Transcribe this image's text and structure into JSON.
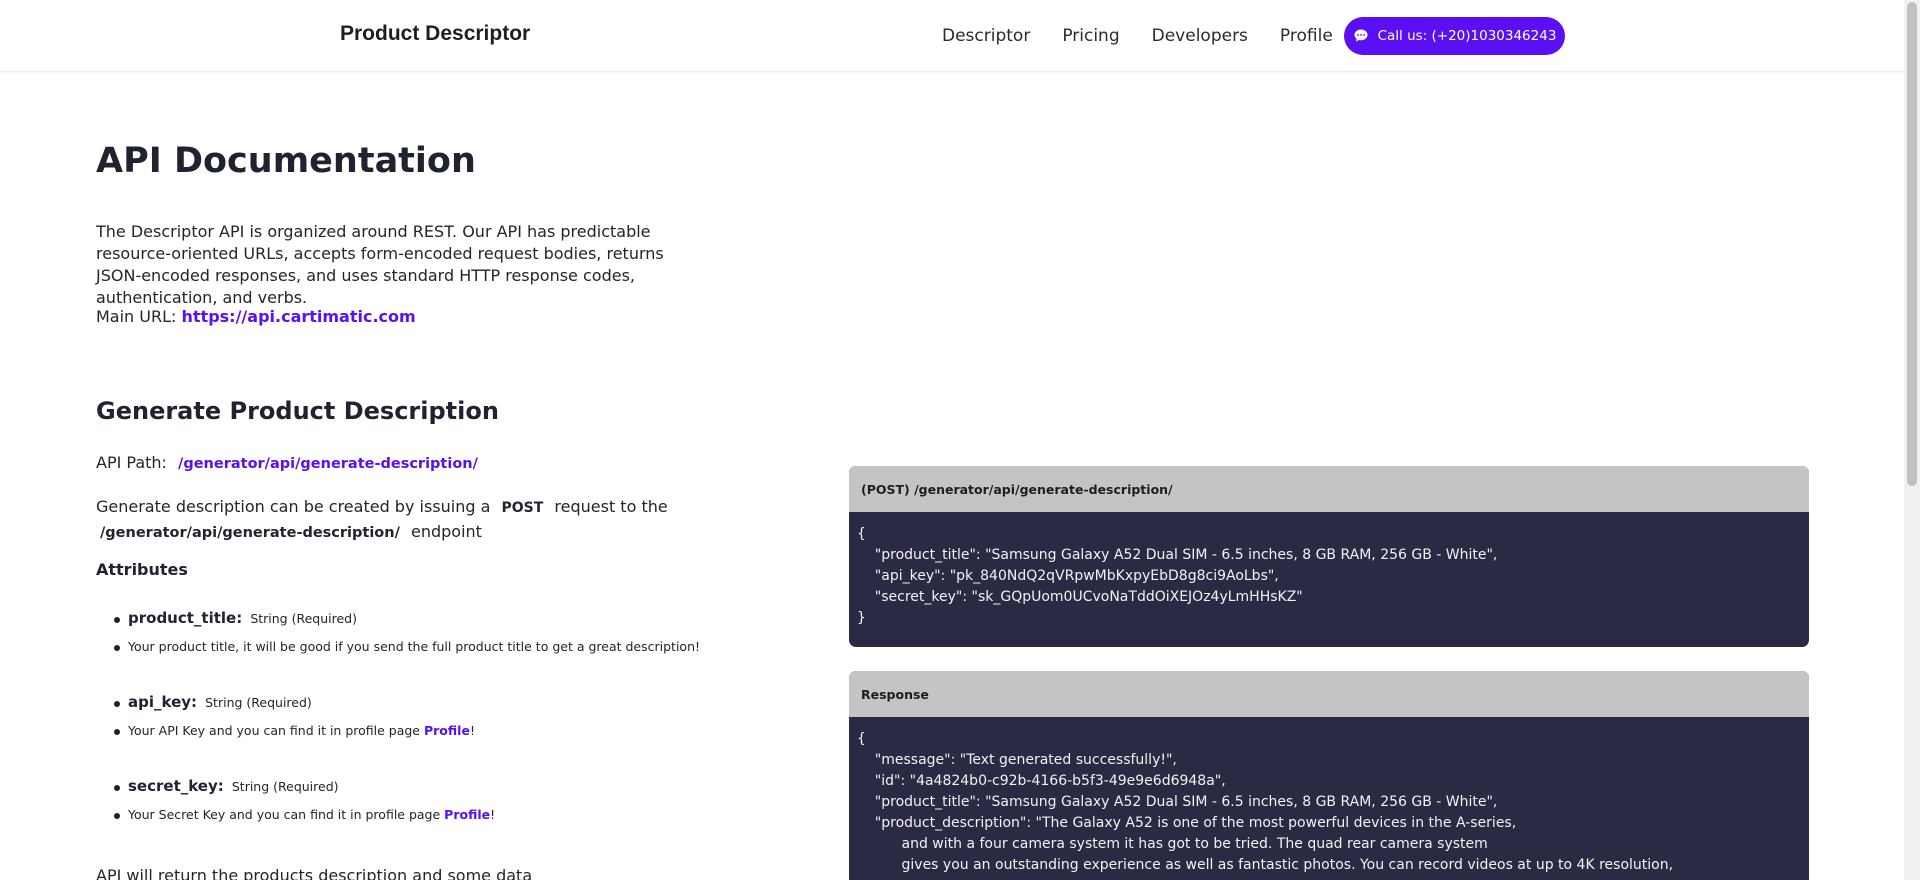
{
  "header": {
    "brand": "Product Descriptor",
    "nav": [
      "Descriptor",
      "Pricing",
      "Developers",
      "Profile"
    ],
    "call_label": "Call us: (+20)1030346243"
  },
  "main": {
    "title": "API Documentation",
    "intro": "The Descriptor API is organized around REST. Our API has predictable resource-oriented URLs, accepts form-encoded request bodies, returns JSON-encoded responses, and uses standard HTTP response codes, authentication, and verbs.",
    "main_url_label": "Main URL:",
    "main_url": "https://api.cartimatic.com",
    "section_title": "Generate Product Description",
    "api_path_label": "API Path:",
    "api_path": "/generator/api/generate-description/",
    "post_text_1": "Generate description can be created by issuing a",
    "post_method": "POST",
    "post_text_2": "request to the",
    "post_endpoint": "/generator/api/generate-description/",
    "post_text_3": "endpoint",
    "attributes_heading": "Attributes",
    "attributes": [
      {
        "name": "product_title:",
        "type": "String (Required)",
        "desc": "Your product title, it will be good if you send the full product title to get a great description!",
        "link": ""
      },
      {
        "name": "api_key:",
        "type": "String (Required)",
        "desc": "Your API Key and you can find it in profile page",
        "link": "Profile",
        "suffix": "!"
      },
      {
        "name": "secret_key:",
        "type": "String (Required)",
        "desc": "Your Secret Key and you can find it in profile page",
        "link": "Profile",
        "suffix": "!"
      }
    ],
    "tail": "API will return the products description and some data"
  },
  "request_panel": {
    "title": "(POST) /generator/api/generate-description/",
    "body": "{\n    \"product_title\": \"Samsung Galaxy A52 Dual SIM - 6.5 inches, 8 GB RAM, 256 GB - White\",\n    \"api_key\": \"pk_840NdQ2qVRpwMbKxpyEbD8g8ci9AoLbs\",\n    \"secret_key\": \"sk_GQpUom0UCvoNaTddOiXEJOz4yLmHHsKZ\"\n}"
  },
  "response_panel": {
    "title": "Response",
    "body": "{\n    \"message\": \"Text generated successfully!\",\n    \"id\": \"4a4824b0-c92b-4166-b5f3-49e9e6d6948a\",\n    \"product_title\": \"Samsung Galaxy A52 Dual SIM - 6.5 inches, 8 GB RAM, 256 GB - White\",\n    \"product_description\": \"The Galaxy A52 is one of the most powerful devices in the A-series,\n          and with a four camera system it has got to be tried. The quad rear camera system\n          gives you an outstanding experience as well as fantastic photos. You can record videos at up to 4K resolution,"
  },
  "colors": {
    "accent": "#5a10f2",
    "panel_bg": "#2a2a44",
    "panel_head": "#c4c4c4"
  },
  "icons": {
    "call": "chat-bubble-icon"
  }
}
